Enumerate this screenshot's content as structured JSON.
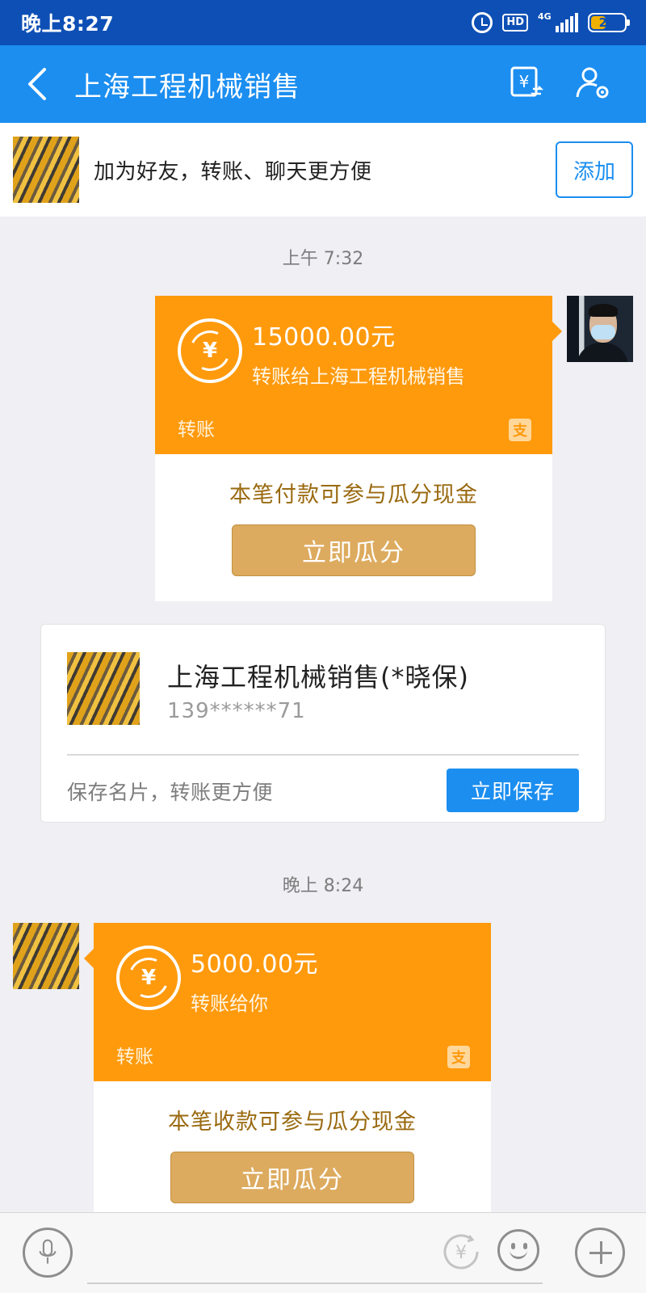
{
  "status_bar": {
    "time": "晚上8:27",
    "hd_badge": "HD",
    "network": "4G",
    "battery": "29"
  },
  "header": {
    "title": "上海工程机械销售"
  },
  "friend_banner": {
    "text": "加为好友，转账、聊天更方便",
    "add_label": "添加"
  },
  "messages": {
    "timestamp_1": "上午 7:32",
    "transfer_out": {
      "amount": "15000.00元",
      "description": "转账给上海工程机械销售",
      "type": "转账",
      "promo": "本笔付款可参与瓜分现金",
      "action": "立即瓜分"
    },
    "contact_card": {
      "name": "上海工程机械销售(*晓保)",
      "phone": "139******71",
      "tip": "保存名片，转账更方便",
      "save_label": "立即保存"
    },
    "timestamp_2": "晚上 8:24",
    "transfer_in": {
      "amount": "5000.00元",
      "description": "转账给你",
      "type": "转账",
      "promo": "本笔收款可参与瓜分现金",
      "action": "立即瓜分"
    }
  },
  "icons": {
    "back": "chevron-left-icon",
    "transfer": "yuan-transfer-icon",
    "settings": "user-settings-icon",
    "voice": "microphone-icon",
    "money": "yuan-icon",
    "emoji": "smiley-icon",
    "more": "plus-icon"
  },
  "colors": {
    "status_bar": "#0d4fb5",
    "header": "#1b8ef0",
    "transfer_orange": "#ff9a0d",
    "split_button": "#ddab5f",
    "promo_text": "#9a6a10",
    "save_button": "#1b8ef0"
  }
}
